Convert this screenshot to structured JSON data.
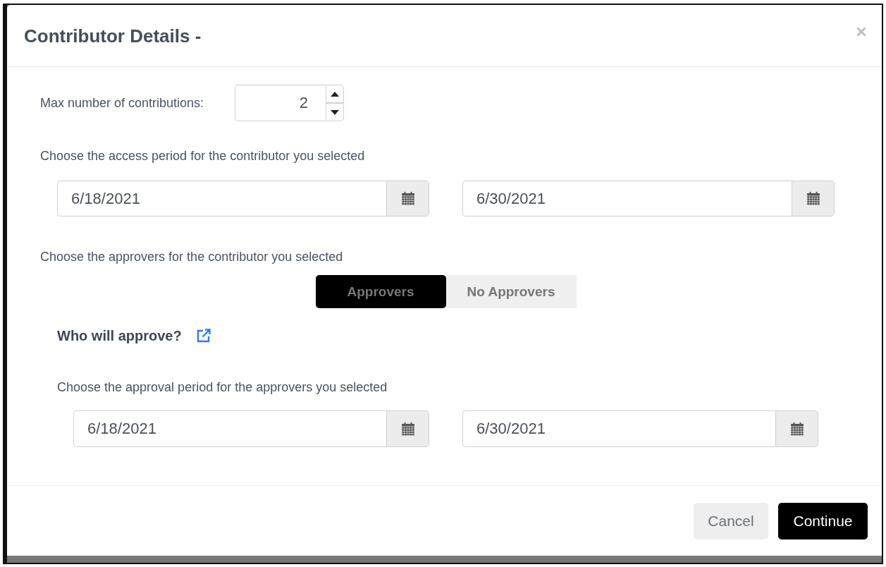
{
  "dialog": {
    "title": "Contributor Details -"
  },
  "max_contributions": {
    "label": "Max number of contributions:",
    "value": "2"
  },
  "access_period": {
    "label": "Choose the access period for the contributor you selected",
    "start": "6/18/2021",
    "end": "6/30/2021"
  },
  "approvers": {
    "label": "Choose the approvers for the contributor you selected",
    "options": [
      {
        "label": "Approvers",
        "selected": true
      },
      {
        "label": "No Approvers",
        "selected": false
      }
    ]
  },
  "who_will_approve": {
    "label": "Who will approve?"
  },
  "approval_period": {
    "label": "Choose the approval period for the approvers you selected",
    "start": "6/18/2021",
    "end": "6/30/2021"
  },
  "buttons": [
    {
      "label": "Cancel",
      "kind": "secondary"
    },
    {
      "label": "Continue",
      "kind": "primary"
    }
  ]
}
